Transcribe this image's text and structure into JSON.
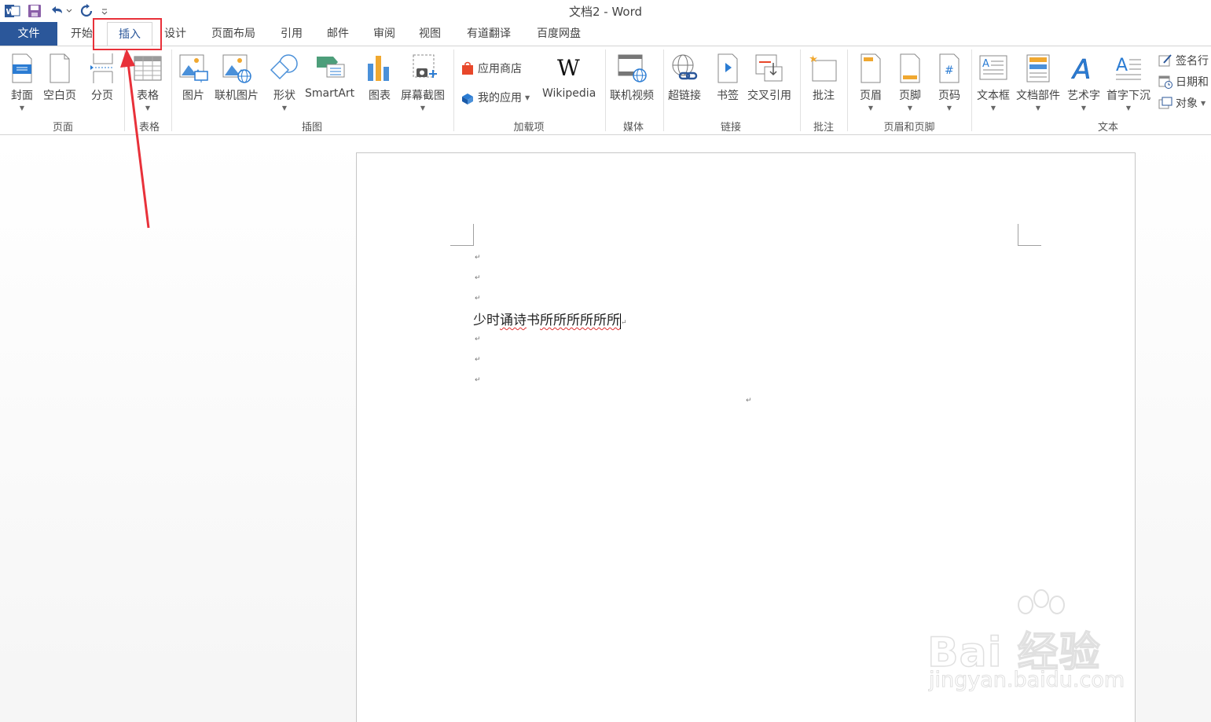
{
  "window": {
    "title": "文档2 - Word",
    "accent_color": "#2b579a"
  },
  "qat": {
    "icons": [
      "word-logo-icon",
      "save-icon",
      "undo-icon",
      "redo-icon",
      "customize-qat-icon"
    ]
  },
  "tabs": [
    {
      "label": "文件"
    },
    {
      "label": "开始"
    },
    {
      "label": "插入"
    },
    {
      "label": "设计"
    },
    {
      "label": "页面布局"
    },
    {
      "label": "引用"
    },
    {
      "label": "邮件"
    },
    {
      "label": "审阅"
    },
    {
      "label": "视图"
    },
    {
      "label": "有道翻译"
    },
    {
      "label": "百度网盘"
    }
  ],
  "ribbon": {
    "pages": {
      "label": "页面",
      "buttons": [
        "封面",
        "空白页",
        "分页"
      ]
    },
    "tables": {
      "label": "表格",
      "buttons": [
        "表格"
      ]
    },
    "illustrations": {
      "label": "插图",
      "buttons": [
        "图片",
        "联机图片",
        "形状",
        "SmartArt",
        "图表",
        "屏幕截图"
      ]
    },
    "addins": {
      "label": "加载项",
      "store": "应用商店",
      "my_apps": "我的应用",
      "wikipedia": "Wikipedia"
    },
    "media": {
      "label": "媒体",
      "buttons": [
        "联机视频"
      ]
    },
    "links": {
      "label": "链接",
      "buttons": [
        "超链接",
        "书签",
        "交叉引用"
      ]
    },
    "comments": {
      "label": "批注",
      "buttons": [
        "批注"
      ]
    },
    "header_footer": {
      "label": "页眉和页脚",
      "buttons": [
        "页眉",
        "页脚",
        "页码"
      ]
    },
    "text": {
      "label": "文本",
      "buttons": [
        "文本框",
        "文档部件",
        "艺术字",
        "首字下沉"
      ],
      "side": [
        "签名行",
        "日期和",
        "对象"
      ]
    }
  },
  "document": {
    "text_plain": "少时",
    "text_squiggle1": "诵诗",
    "text_mid": "书",
    "text_squiggle2": "所所所所所所",
    "paragraph_mark": "↵"
  },
  "watermark": {
    "brand": "Bai 经验",
    "url": "jingyan.baidu.com"
  },
  "annotation": {
    "color": "#e8313a"
  }
}
